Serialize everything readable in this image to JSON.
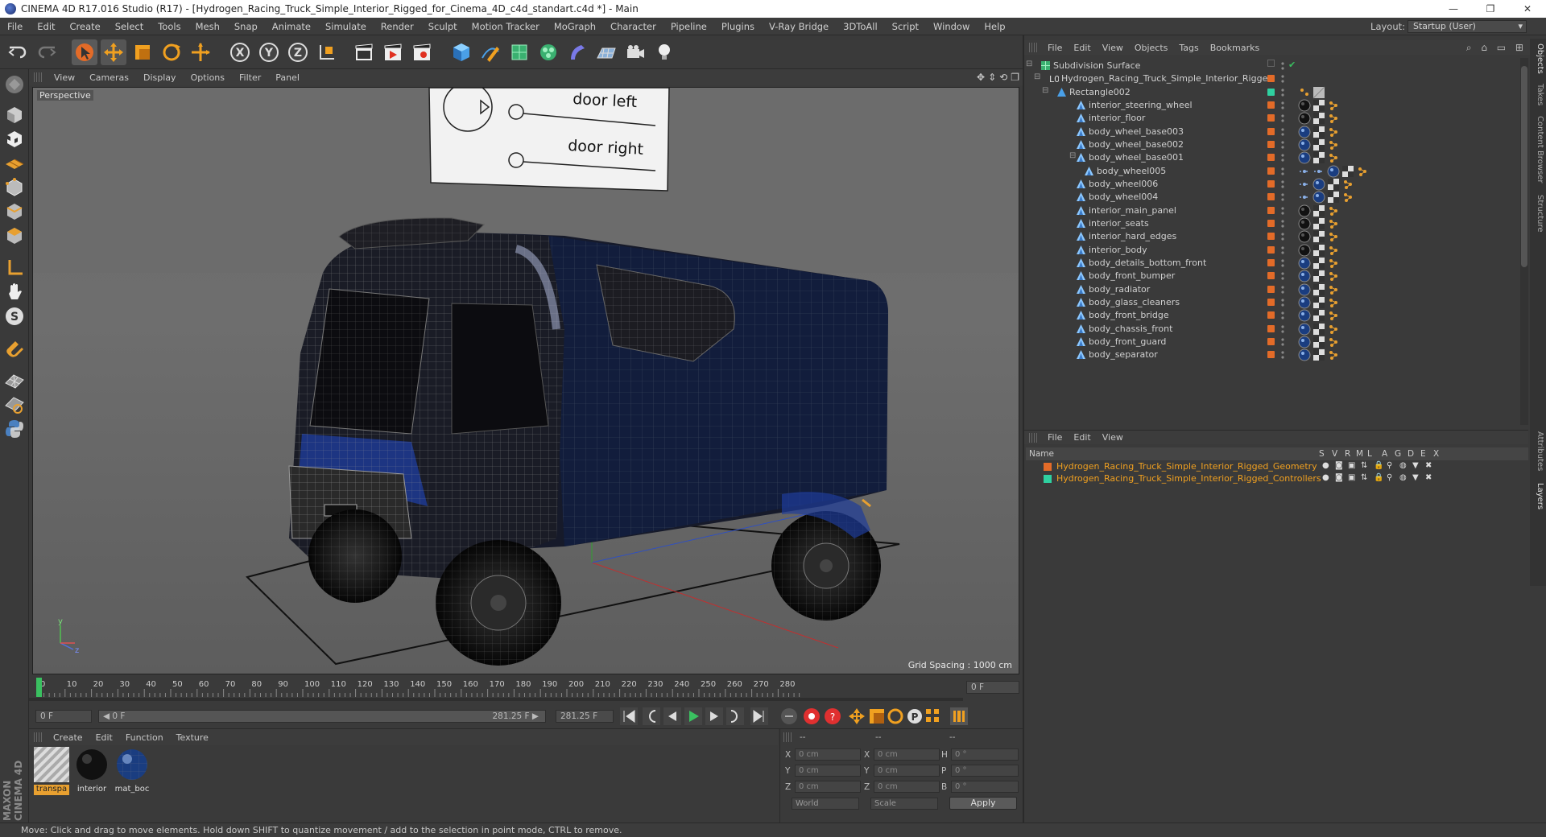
{
  "window": {
    "title": "CINEMA 4D R17.016 Studio (R17) - [Hydrogen_Racing_Truck_Simple_Interior_Rigged_for_Cinema_4D_c4d_standart.c4d *] - Main",
    "controls": [
      "—",
      "❐",
      "✕"
    ]
  },
  "menubar": [
    "File",
    "Edit",
    "Create",
    "Select",
    "Tools",
    "Mesh",
    "Snap",
    "Animate",
    "Simulate",
    "Render",
    "Sculpt",
    "Motion Tracker",
    "MoGraph",
    "Character",
    "Pipeline",
    "Plugins",
    "V-Ray Bridge",
    "3DToAll",
    "Script",
    "Window",
    "Help"
  ],
  "layout": {
    "label": "Layout:",
    "value": "Startup (User)"
  },
  "viewport": {
    "menu": [
      "View",
      "Cameras",
      "Display",
      "Options",
      "Filter",
      "Panel"
    ],
    "label": "Perspective",
    "grid_spacing": "Grid Spacing : 1000 cm",
    "sign": {
      "line1": "door left",
      "line2": "door right"
    },
    "axis_labels": {
      "y": "y",
      "z": "z"
    }
  },
  "timeline": {
    "ticks": [
      "0",
      "10",
      "20",
      "30",
      "40",
      "50",
      "60",
      "70",
      "80",
      "90",
      "100",
      "110",
      "120",
      "130",
      "140",
      "150",
      "160",
      "170",
      "180",
      "190",
      "200",
      "210",
      "220",
      "230",
      "240",
      "250",
      "260",
      "270",
      "280"
    ],
    "end_field": "0 F",
    "start_frame": "0 F",
    "range_start": "◀ 0 F",
    "range_end": "281.25 F ▶",
    "end_frame": "281.25 F"
  },
  "material_manager": {
    "menu": [
      "Create",
      "Edit",
      "Function",
      "Texture"
    ],
    "materials": [
      {
        "label": "transpa",
        "type": "checker"
      },
      {
        "label": "interior",
        "type": "dark"
      },
      {
        "label": "mat_boc",
        "type": "blue"
      }
    ]
  },
  "coordinates": {
    "headers": [
      "--",
      "--",
      "--"
    ],
    "rows": [
      {
        "a": "X",
        "av": "0 cm",
        "b": "X",
        "bv": "0 cm",
        "c": "H",
        "cv": "0 °"
      },
      {
        "a": "Y",
        "av": "0 cm",
        "b": "Y",
        "bv": "0 cm",
        "c": "P",
        "cv": "0 °"
      },
      {
        "a": "Z",
        "av": "0 cm",
        "b": "Z",
        "bv": "0 cm",
        "c": "B",
        "cv": "0 °"
      }
    ],
    "world": "World",
    "scale": "Scale",
    "apply": "Apply"
  },
  "status": "Move: Click and drag to move elements. Hold down SHIFT to quantize movement / add to the selection in point mode, CTRL to remove.",
  "maxon": "MAXON CINEMA 4D",
  "object_manager": {
    "menu": [
      "File",
      "Edit",
      "View",
      "Objects",
      "Tags",
      "Bookmarks"
    ],
    "objects": [
      {
        "name": "Subdivision Surface",
        "indent": 0,
        "kind": "subdiv",
        "tags": []
      },
      {
        "name": "Hydrogen_Racing_Truck_Simple_Interior_Rigged",
        "indent": 1,
        "kind": "null",
        "tags": []
      },
      {
        "name": "Rectangle002",
        "indent": 2,
        "kind": "spline",
        "tags": [
          "tex",
          "grey"
        ]
      },
      {
        "name": "interior_steering_wheel",
        "indent": 3,
        "kind": "poly",
        "tags": [
          "dark",
          "check",
          "dots"
        ]
      },
      {
        "name": "interior_floor",
        "indent": 3,
        "kind": "poly",
        "tags": [
          "dark",
          "check",
          "dots"
        ]
      },
      {
        "name": "body_wheel_base003",
        "indent": 3,
        "kind": "poly",
        "tags": [
          "blue",
          "check",
          "dots"
        ]
      },
      {
        "name": "body_wheel_base002",
        "indent": 3,
        "kind": "poly",
        "tags": [
          "blue",
          "check",
          "dots"
        ]
      },
      {
        "name": "body_wheel_base001",
        "indent": 3,
        "kind": "poly",
        "tags": [
          "blue",
          "check",
          "dots"
        ]
      },
      {
        "name": "body_wheel005",
        "indent": 4,
        "kind": "poly",
        "tags": [
          "joint",
          "joint",
          "blue",
          "check",
          "dots"
        ]
      },
      {
        "name": "body_wheel006",
        "indent": 3,
        "kind": "poly",
        "tags": [
          "joint",
          "blue",
          "check",
          "dots"
        ]
      },
      {
        "name": "body_wheel004",
        "indent": 3,
        "kind": "poly",
        "tags": [
          "joint",
          "blue",
          "check",
          "dots"
        ]
      },
      {
        "name": "interior_main_panel",
        "indent": 3,
        "kind": "poly",
        "tags": [
          "dark",
          "check",
          "dots"
        ]
      },
      {
        "name": "interior_seats",
        "indent": 3,
        "kind": "poly",
        "tags": [
          "dark",
          "check",
          "dots"
        ]
      },
      {
        "name": "interior_hard_edges",
        "indent": 3,
        "kind": "poly",
        "tags": [
          "dark",
          "check",
          "dots"
        ]
      },
      {
        "name": "interior_body",
        "indent": 3,
        "kind": "poly",
        "tags": [
          "dark",
          "check",
          "dots"
        ]
      },
      {
        "name": "body_details_bottom_front",
        "indent": 3,
        "kind": "poly",
        "tags": [
          "blue",
          "check",
          "dots"
        ]
      },
      {
        "name": "body_front_bumper",
        "indent": 3,
        "kind": "poly",
        "tags": [
          "blue",
          "check",
          "dots"
        ]
      },
      {
        "name": "body_radiator",
        "indent": 3,
        "kind": "poly",
        "tags": [
          "blue",
          "check",
          "dots"
        ]
      },
      {
        "name": "body_glass_cleaners",
        "indent": 3,
        "kind": "poly",
        "tags": [
          "blue",
          "check",
          "dots"
        ]
      },
      {
        "name": "body_front_bridge",
        "indent": 3,
        "kind": "poly",
        "tags": [
          "blue",
          "check",
          "dots"
        ]
      },
      {
        "name": "body_chassis_front",
        "indent": 3,
        "kind": "poly",
        "tags": [
          "blue",
          "check",
          "dots"
        ]
      },
      {
        "name": "body_front_guard",
        "indent": 3,
        "kind": "poly",
        "tags": [
          "blue",
          "check",
          "dots"
        ]
      },
      {
        "name": "body_separator",
        "indent": 3,
        "kind": "poly",
        "tags": [
          "blue",
          "check",
          "dots"
        ]
      }
    ]
  },
  "side_tabs": [
    "Objects",
    "Takes",
    "Content Browser",
    "Structure"
  ],
  "side_tabs_lower": [
    "Attributes",
    "Layers"
  ],
  "layer_manager": {
    "menu": [
      "File",
      "Edit",
      "View"
    ],
    "columns": [
      "Name",
      "S",
      "V",
      "R",
      "M",
      "L",
      "A",
      "G",
      "D",
      "E",
      "X"
    ],
    "layers": [
      {
        "name": "Hydrogen_Racing_Truck_Simple_Interior_Rigged_Geometry",
        "color": "#e36b28"
      },
      {
        "name": "Hydrogen_Racing_Truck_Simple_Interior_Rigged_Controllers",
        "color": "#2fd0a0"
      }
    ]
  },
  "colors": {
    "accent_orange": "#e8a030",
    "layer_text": "#f0a020",
    "blue_icon": "#4a90e0"
  }
}
